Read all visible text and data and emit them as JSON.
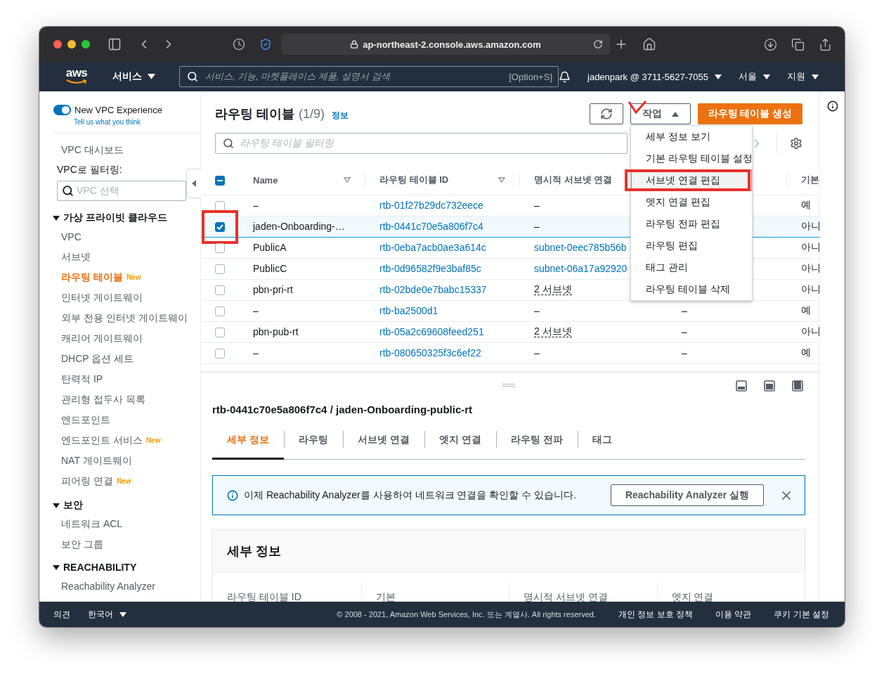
{
  "browser": {
    "url": "ap-northeast-2.console.aws.amazon.com"
  },
  "nav": {
    "logo": "aws",
    "services": "서비스",
    "search_placeholder": "서비스, 기능, 마켓플레이스 제품, 설명서 검색",
    "search_shortcut": "[Option+S]",
    "account": "jadenpark @ 3711-5627-7055",
    "region": "서울",
    "support": "지원"
  },
  "sidebar": {
    "toggle": {
      "label": "New VPC Experience",
      "on": true
    },
    "feedback_link": "Tell us what you think",
    "dashboard": "VPC 대시보드",
    "filter_label": "VPC로 필터링:",
    "filter_placeholder": "VPC 선택",
    "sections": [
      {
        "title": "가상 프라이빗 클라우드",
        "expanded": true,
        "items": [
          {
            "label": "VPC",
            "selected": false
          },
          {
            "label": "서브넷",
            "selected": false
          },
          {
            "label": "라우팅 테이블",
            "selected": true,
            "badge": "New"
          },
          {
            "label": "인터넷 게이트웨이",
            "selected": false
          },
          {
            "label": "외부 전용 인터넷 게이트웨이",
            "selected": false
          },
          {
            "label": "캐리어 게이트웨이",
            "selected": false
          },
          {
            "label": "DHCP 옵션 세트",
            "selected": false
          },
          {
            "label": "탄력적 IP",
            "selected": false
          },
          {
            "label": "관리형 접두사 목록",
            "selected": false
          },
          {
            "label": "엔드포인트",
            "selected": false
          },
          {
            "label": "엔드포인트 서비스",
            "selected": false,
            "badge": "New"
          },
          {
            "label": "NAT 게이트웨이",
            "selected": false
          },
          {
            "label": "피어링 연결",
            "selected": false,
            "badge": "New"
          }
        ]
      },
      {
        "title": "보안",
        "expanded": true,
        "items": [
          {
            "label": "네트워크 ACL",
            "selected": false
          },
          {
            "label": "보안 그룹",
            "selected": false
          }
        ]
      },
      {
        "title": "REACHABILITY",
        "expanded": true,
        "items": [
          {
            "label": "Reachability Analyzer",
            "selected": false
          }
        ]
      }
    ]
  },
  "header": {
    "title": "라우팅 테이블",
    "count": "(1/9)",
    "info": "정보",
    "actions": "작업",
    "actions_marked": true,
    "create": "라우팅 테이블 생성"
  },
  "filter_placeholder": "라우팅 테이블 필터링",
  "menu": [
    {
      "label": "세부 정보 보기",
      "hovered": false
    },
    {
      "label": "기본 라우팅 테이블 설정",
      "hovered": false
    },
    {
      "label": "서브넷 연결 편집",
      "hovered": true,
      "marked": true
    },
    {
      "label": "엣지 연결 편집",
      "hovered": false
    },
    {
      "label": "라우팅 전파 편집",
      "hovered": false
    },
    {
      "label": "라우팅 편집",
      "hovered": false
    },
    {
      "label": "태그 관리",
      "hovered": false
    },
    {
      "label": "라우팅 테이블 삭제",
      "hovered": false
    }
  ],
  "table": {
    "select_all": {
      "partial": true
    },
    "columns": [
      {
        "label": "Name",
        "sortable": true
      },
      {
        "label": "라우팅 테이블 ID",
        "sortable": true
      },
      {
        "label": "명시적 서브넷 연결"
      },
      {
        "label": "기본"
      }
    ],
    "rows": [
      {
        "checked": false,
        "name": "–",
        "id": "rtb-01f27b29dc732eece",
        "subnet": {
          "text": "–",
          "kind": "text"
        },
        "default": "예"
      },
      {
        "checked": true,
        "marked": true,
        "name": "jaden-Onboarding-…",
        "id": "rtb-0441c70e5a806f7c4",
        "subnet": {
          "text": "–",
          "kind": "text"
        },
        "default": "아니"
      },
      {
        "checked": false,
        "name": "PublicA",
        "id": "rtb-0eba7acb0ae3a614c",
        "subnet": {
          "text": "subnet-0eec785b56b",
          "kind": "link"
        },
        "default": "아니"
      },
      {
        "checked": false,
        "name": "PublicC",
        "id": "rtb-0d96582f9e3baf85c",
        "subnet": {
          "text": "subnet-06a17a92920",
          "kind": "link"
        },
        "default": "아니"
      },
      {
        "checked": false,
        "name": "pbn-pri-rt",
        "id": "rtb-02bde0e7babc15337",
        "subnet": {
          "text": "2 서브넷",
          "kind": "count"
        },
        "default": "아니"
      },
      {
        "checked": false,
        "name": "–",
        "id": "rtb-ba2500d1",
        "subnet": {
          "text": "–",
          "kind": "text"
        },
        "column_5": "–",
        "default": "예"
      },
      {
        "checked": false,
        "name": "pbn-pub-rt",
        "id": "rtb-05a2c69608feed251",
        "subnet": {
          "text": "2 서브넷",
          "kind": "count"
        },
        "column_5": "–",
        "default": "아니"
      },
      {
        "checked": false,
        "name": "–",
        "id": "rtb-080650325f3c6ef22",
        "subnet": {
          "text": "–",
          "kind": "text"
        },
        "column_5": "–",
        "default": "예"
      }
    ]
  },
  "detail": {
    "title": "rtb-0441c70e5a806f7c4 / jaden-Onboarding-public-rt",
    "tabs": [
      {
        "label": "세부 정보",
        "selected": true
      },
      {
        "label": "라우팅",
        "selected": false
      },
      {
        "label": "서브넷 연결",
        "selected": false
      },
      {
        "label": "엣지 연결",
        "selected": false
      },
      {
        "label": "라우팅 전파",
        "selected": false
      },
      {
        "label": "태그",
        "selected": false
      }
    ],
    "alert": {
      "text": "이제 Reachability Analyzer를 사용하여 네트워크 연결을 확인할 수 있습니다.",
      "button": "Reachability Analyzer 실행"
    },
    "card": {
      "title": "세부 정보",
      "fields": [
        "라우팅 테이블 ID",
        "기본",
        "명시적 서브넷 연결",
        "엣지 연결"
      ]
    }
  },
  "footer": {
    "feedback": "의견",
    "language": "한국어",
    "copyright": "© 2008 - 2021, Amazon Web Services, Inc. 또는 계열사. All rights reserved.",
    "links": [
      "개인 정보 보호 정책",
      "이용 약관",
      "쿠키 기본 설정"
    ]
  }
}
